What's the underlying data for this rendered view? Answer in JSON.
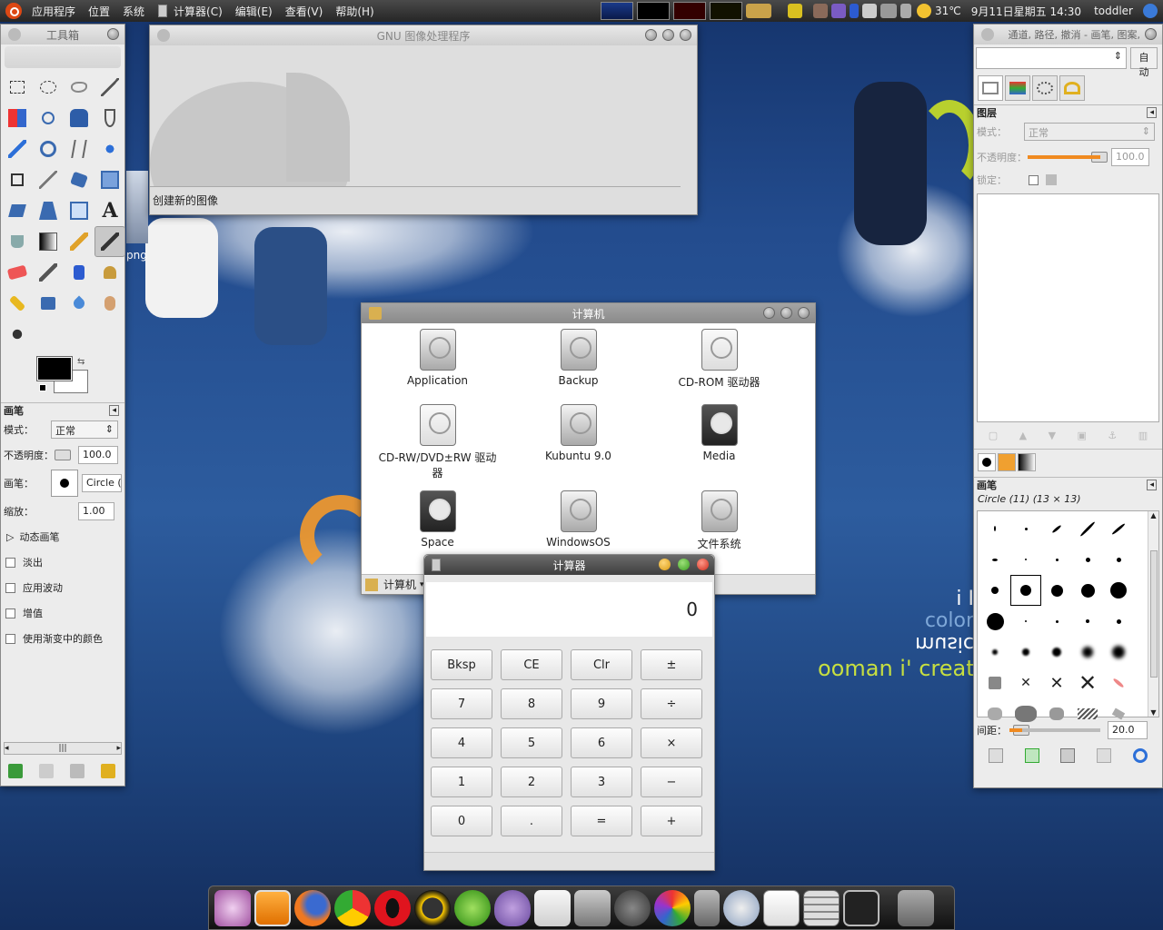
{
  "desktop": {
    "side_label": "png",
    "text_lines": [
      "i I",
      "color",
      "music",
      "ooman i' creat"
    ]
  },
  "top_panel": {
    "menus": [
      "应用程序",
      "位置",
      "系统"
    ],
    "app_menus": [
      "计算器(C)",
      "编辑(E)",
      "查看(V)",
      "帮助(H)"
    ],
    "weather": "31℃",
    "datetime": "9月11日星期五 14:30",
    "user": "toddler"
  },
  "toolbox": {
    "title": "工具箱",
    "tools": [
      "rect-select",
      "ellipse-select",
      "free-select",
      "fuzzy-select",
      "color-select",
      "scissors",
      "foreground-select",
      "paths",
      "color-picker",
      "zoom",
      "measure",
      "move",
      "align",
      "crop",
      "rotate",
      "scale",
      "shear",
      "perspective",
      "flip",
      "text",
      "bucket-fill",
      "blend",
      "pencil",
      "paintbrush",
      "eraser",
      "airbrush",
      "ink",
      "clone",
      "heal",
      "perspective-clone",
      "blur",
      "smudge",
      "dodge-burn"
    ],
    "section_title": "画笔",
    "mode_label": "模式：",
    "mode_value": "正常",
    "opacity_label": "不透明度：",
    "opacity_value": "100.0",
    "brush_label": "画笔：",
    "brush_value": "Circle (1",
    "scale_label": "缩放：",
    "scale_value": "1.00",
    "dynamics": "动态画笔",
    "checks": [
      "淡出",
      "应用波动",
      "增值",
      "使用渐变中的颜色"
    ]
  },
  "gimp_main": {
    "title": "GNU 图像处理程序",
    "status": "创建新的图像"
  },
  "computer": {
    "title": "计算机",
    "items": [
      {
        "name": "Application",
        "icon": "drive-icon"
      },
      {
        "name": "Backup",
        "icon": "drive-icon"
      },
      {
        "name": "CD-ROM 驱动器",
        "icon": "cdrom-icon"
      },
      {
        "name": "CD-RW/DVD±RW 驱动器",
        "icon": "cdrw-icon"
      },
      {
        "name": "Kubuntu 9.0",
        "icon": "drive-icon"
      },
      {
        "name": "Media",
        "icon": "drive-dark-icon"
      },
      {
        "name": "Space",
        "icon": "drive-dark-icon"
      },
      {
        "name": "WindowsOS",
        "icon": "drive-icon"
      },
      {
        "name": "文件系统",
        "icon": "drive-icon"
      }
    ],
    "location": "计算机"
  },
  "calculator": {
    "title": "计算器",
    "display": "0",
    "keys": [
      "Bksp",
      "CE",
      "Clr",
      "±",
      "7",
      "8",
      "9",
      "÷",
      "4",
      "5",
      "6",
      "×",
      "1",
      "2",
      "3",
      "−",
      "0",
      ".",
      "=",
      "+"
    ]
  },
  "right_dock": {
    "tab_menu": "通道, 路径, 撤消 - 画笔, 图案,",
    "auto": "自动",
    "layers_title": "图层",
    "mode_label": "模式：",
    "mode_value": "正常",
    "opacity_label": "不透明度：",
    "opacity_value": "100.0",
    "lock_label": "锁定：",
    "brushes_title": "画笔",
    "brush_name": "Circle (11) (13 × 13)",
    "spacing_label": "间距：",
    "spacing_value": "20.0"
  },
  "dock": {
    "apps": [
      "settings-icon",
      "desktop-icon",
      "firefox-icon",
      "chrome-icon",
      "opera-icon",
      "qq-icon",
      "basketball-icon",
      "pidgin-icon",
      "mail-icon",
      "install-icon",
      "gimp-icon",
      "picasa-icon",
      "speaker-icon",
      "media-icon",
      "text-editor-icon",
      "calculator-icon",
      "terminal-icon",
      "trash-icon"
    ]
  }
}
